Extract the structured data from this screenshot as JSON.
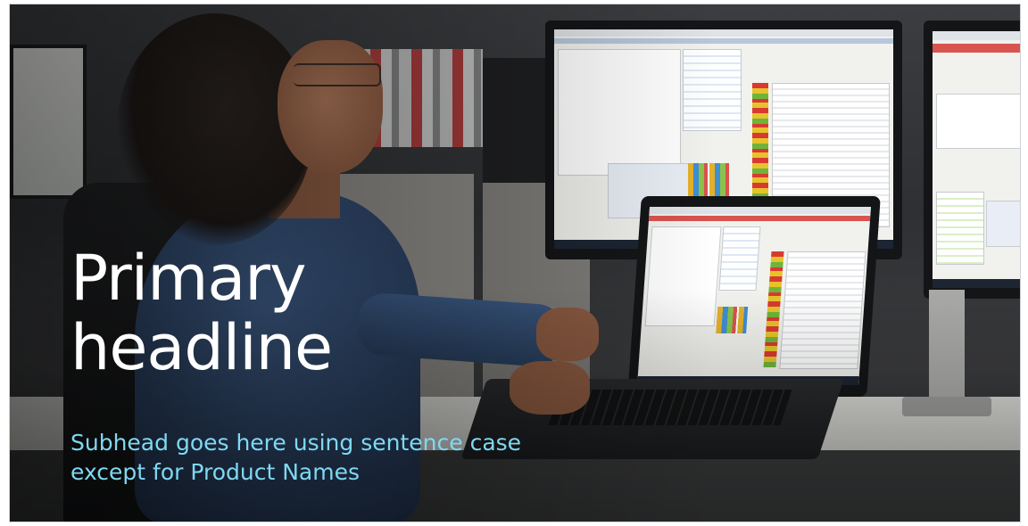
{
  "slide": {
    "headline": "Primary\nheadline",
    "subhead": "Subhead goes here using sentence case\nexcept for Product Names"
  },
  "colors": {
    "headline": "#ffffff",
    "subhead": "#7fd8f3",
    "frame_border": "#cfd3d6"
  },
  "image": {
    "subject": "woman-at-workstation-photo",
    "icon": "photo-background"
  }
}
